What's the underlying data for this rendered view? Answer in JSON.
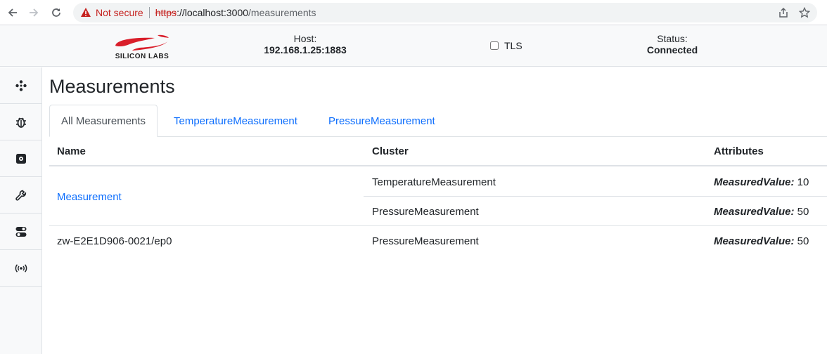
{
  "browser": {
    "security_label": "Not secure",
    "url_scheme": "https",
    "url_host": "://localhost:3000",
    "url_path": "/measurements"
  },
  "header": {
    "logo_text": "SILICON LABS",
    "host_label": "Host:",
    "host_value": "192.168.1.25:1883",
    "tls_label": "TLS",
    "status_label": "Status:",
    "status_value": "Connected"
  },
  "sidebar": {
    "items": [
      {
        "icon": "nodes-icon"
      },
      {
        "icon": "bug-icon"
      },
      {
        "icon": "cluster-icon"
      },
      {
        "icon": "wrench-icon"
      },
      {
        "icon": "toggles-icon"
      },
      {
        "icon": "broadcast-icon"
      }
    ]
  },
  "page": {
    "title": "Measurements",
    "tabs": [
      {
        "label": "All Measurements"
      },
      {
        "label": "TemperatureMeasurement"
      },
      {
        "label": "PressureMeasurement"
      }
    ],
    "table": {
      "headers": {
        "name": "Name",
        "cluster": "Cluster",
        "attributes": "Attributes"
      },
      "rows": [
        {
          "name": "Measurement",
          "cluster": "TemperatureMeasurement",
          "attr_key": "MeasuredValue:",
          "attr_val": "10"
        },
        {
          "name": "",
          "cluster": "PressureMeasurement",
          "attr_key": "MeasuredValue:",
          "attr_val": "50"
        },
        {
          "name": "zw-E2E1D906-0021/ep0",
          "cluster": "PressureMeasurement",
          "attr_key": "MeasuredValue:",
          "attr_val": "50"
        }
      ]
    }
  },
  "colors": {
    "link": "#0d6efd",
    "brand_red": "#d91e2a",
    "warning_red": "#c5221f"
  }
}
